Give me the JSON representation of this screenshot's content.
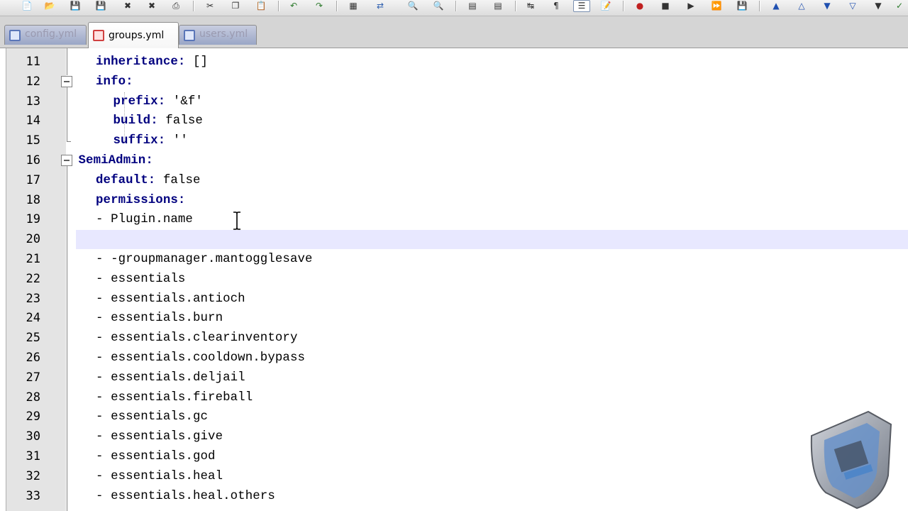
{
  "tabs": [
    {
      "label": "config.yml",
      "active": false
    },
    {
      "label": "groups.yml",
      "active": true
    },
    {
      "label": "users.yml",
      "active": false
    }
  ],
  "lines": [
    {
      "no": "11",
      "indent": 2,
      "key": "inheritance",
      "value": " []"
    },
    {
      "no": "12",
      "indent": 2,
      "key": "info",
      "value": ""
    },
    {
      "no": "13",
      "indent": 3,
      "key": "prefix",
      "value": " '&f'"
    },
    {
      "no": "14",
      "indent": 3,
      "key": "build",
      "value": " false"
    },
    {
      "no": "15",
      "indent": 3,
      "key": "suffix",
      "value": " ''"
    },
    {
      "no": "16",
      "indent": 1,
      "key": "SemiAdmin",
      "value": ""
    },
    {
      "no": "17",
      "indent": 2,
      "key": "default",
      "value": " false"
    },
    {
      "no": "18",
      "indent": 2,
      "key": "permissions",
      "value": ""
    },
    {
      "no": "19",
      "indent": 2,
      "text": "- Plugin.name"
    },
    {
      "no": "20",
      "indent": 0,
      "text": ""
    },
    {
      "no": "21",
      "indent": 2,
      "text": "- -groupmanager.mantogglesave"
    },
    {
      "no": "22",
      "indent": 2,
      "text": "- essentials"
    },
    {
      "no": "23",
      "indent": 2,
      "text": "- essentials.antioch"
    },
    {
      "no": "24",
      "indent": 2,
      "text": "- essentials.burn"
    },
    {
      "no": "25",
      "indent": 2,
      "text": "- essentials.clearinventory"
    },
    {
      "no": "26",
      "indent": 2,
      "text": "- essentials.cooldown.bypass"
    },
    {
      "no": "27",
      "indent": 2,
      "text": "- essentials.deljail"
    },
    {
      "no": "28",
      "indent": 2,
      "text": "- essentials.fireball"
    },
    {
      "no": "29",
      "indent": 2,
      "text": "- essentials.gc"
    },
    {
      "no": "30",
      "indent": 2,
      "text": "- essentials.give"
    },
    {
      "no": "31",
      "indent": 2,
      "text": "- essentials.god"
    },
    {
      "no": "32",
      "indent": 2,
      "text": "- essentials.heal"
    },
    {
      "no": "33",
      "indent": 2,
      "text": "- essentials.heal.others"
    }
  ],
  "current_line": "20",
  "toolbar_icons": [
    "new-file-icon",
    "open-file-icon",
    "save-icon",
    "save-all-icon",
    "close-icon",
    "close-all-icon",
    "print-icon",
    "cut-icon",
    "copy-icon",
    "paste-icon",
    "undo-icon",
    "redo-icon",
    "find-icon",
    "replace-icon",
    "zoom-in-icon",
    "zoom-out-icon",
    "sync-vertical-icon",
    "sync-horizontal-icon",
    "word-wrap-icon",
    "show-all-chars-icon",
    "indent-guide-icon",
    "language-icon",
    "record-macro-icon",
    "stop-macro-icon",
    "play-macro-icon",
    "play-multiple-icon",
    "save-macro-icon",
    "move-up-icon",
    "move-down-icon",
    "bookmark-icon",
    "spellcheck-icon"
  ],
  "colors": {
    "key": "#00007f",
    "current_line": "#e8e8ff",
    "gutter": "#e4e4e4"
  }
}
